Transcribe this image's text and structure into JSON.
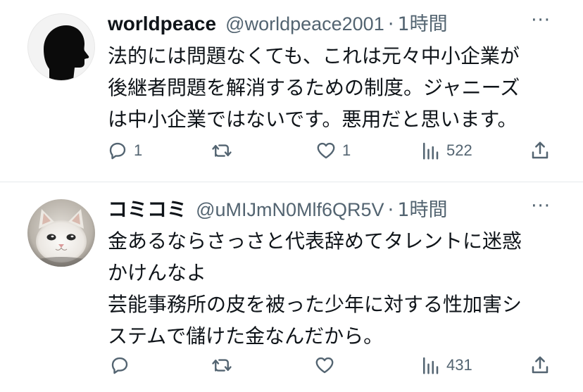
{
  "tweets": [
    {
      "author_name": "worldpeace",
      "handle": "@worldpeace2001",
      "separator": "·",
      "time": "1時間",
      "more": "···",
      "lines": [
        "法的には問題なくても、これは元々中小企業が",
        "後継者問題を解消するための制度。ジャニーズ",
        "は中小企業ではないです。悪用だと思います。"
      ],
      "reply_count": "1",
      "retweet_count": "",
      "like_count": "1",
      "view_count": "522"
    },
    {
      "author_name": "コミコミ",
      "handle": "@uMIJmN0Mlf6QR5V",
      "separator": "·",
      "time": "1時間",
      "more": "···",
      "lines": [
        "金あるならさっさと代表辞めてタレントに迷惑",
        "かけんなよ",
        "芸能事務所の皮を被った少年に対する性加害シ",
        "ステムで儲けた金なんだから。"
      ],
      "reply_count": "",
      "retweet_count": "",
      "like_count": "",
      "view_count": "431"
    }
  ],
  "icons": {
    "avatar1": "silhouette-head-avatar",
    "avatar2": "white-cat-avatar",
    "reply": "reply-icon",
    "retweet": "retweet-icon",
    "like": "heart-icon",
    "views": "views-bar-chart-icon",
    "share": "share-icon"
  },
  "colors": {
    "text": "#0f1419",
    "secondary": "#536471",
    "divider": "#e6e9ec"
  }
}
